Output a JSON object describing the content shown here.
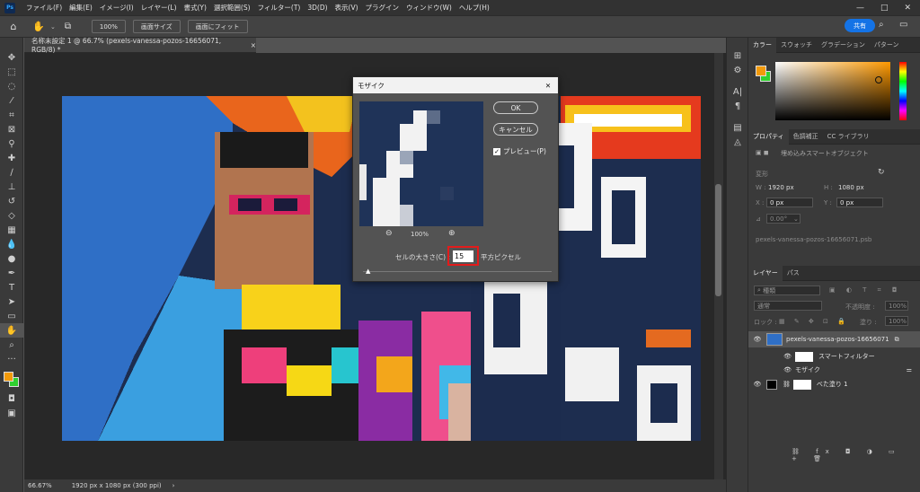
{
  "app": {
    "logo": "Ps",
    "title_window_controls": [
      "—",
      "□",
      "✕"
    ]
  },
  "menu": [
    "ファイル(F)",
    "編集(E)",
    "イメージ(I)",
    "レイヤー(L)",
    "書式(Y)",
    "選択範囲(S)",
    "フィルター(T)",
    "3D(D)",
    "表示(V)",
    "プラグイン",
    "ウィンドウ(W)",
    "ヘルプ(H)"
  ],
  "options_bar": {
    "zoom_btn": "100%",
    "fit_screen_btn": "画面サイズ",
    "fill_screen_btn": "画面にフィット",
    "share_btn": "共有"
  },
  "document": {
    "tab_title": "名称未設定 1 @ 66.7% (pexels-vanessa-pozos-16656071, RGB/8) *",
    "close": "×"
  },
  "status": {
    "zoom": "66.67%",
    "doc_info": "1920 px x 1080 px (300 ppi)",
    "arrow": "›"
  },
  "dialog": {
    "title": "モザイク",
    "close": "✕",
    "ok": "OK",
    "cancel": "キャンセル",
    "preview_label": "プレビュー(P)",
    "preview_checked": true,
    "zoom_pct": "100%",
    "cell_label": "セルの大きさ(C) :",
    "cell_value": "15",
    "unit": "平方ピクセル",
    "slider_value": 15
  },
  "color_panel": {
    "tabs": [
      "カラー",
      "スウォッチ",
      "グラデーション",
      "パターン"
    ],
    "fg_color": "#f29a0a",
    "bg_color": "#2fd12f"
  },
  "properties_panel": {
    "tabs": [
      "プロパティ",
      "色調補正",
      "CC ライブラリ"
    ],
    "type": "埋め込みスマートオブジェクト",
    "section": "変形",
    "w_label": "W :",
    "w": "1920 px",
    "h_label": "H :",
    "h": "1080 px",
    "x_label": "X :",
    "x": "0 px",
    "y_label": "Y :",
    "y": "0 px",
    "angle": "0.00°",
    "filename": "pexels-vanessa-pozos-16656071.psb"
  },
  "layers_panel": {
    "tabs": [
      "レイヤー",
      "パス"
    ],
    "search": "種類",
    "blend": "通常",
    "opacity_label": "不透明度 :",
    "opacity": "100%",
    "lock_label": "ロック :",
    "fill_label": "塗り :",
    "fill": "100%",
    "layers": [
      {
        "name": "pexels-vanessa-pozos-16656071"
      },
      {
        "name": "スマートフィルター"
      },
      {
        "name": "モザイク"
      },
      {
        "name": "べた塗り 1"
      }
    ]
  }
}
